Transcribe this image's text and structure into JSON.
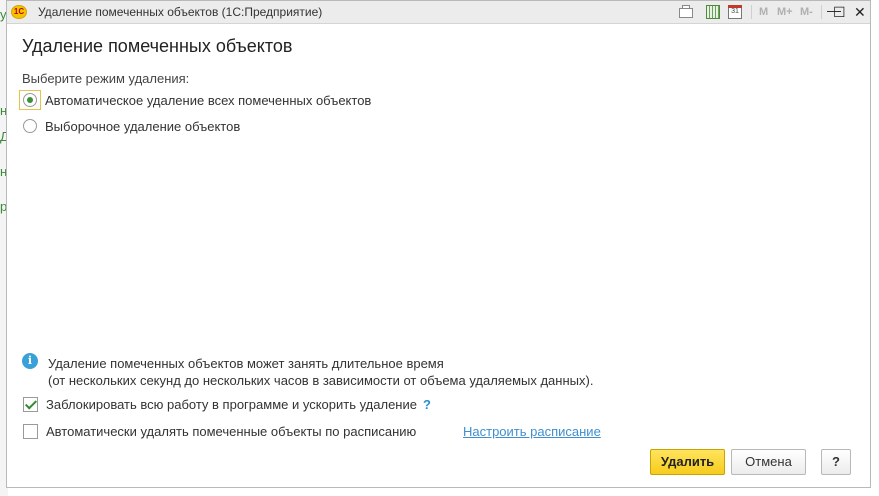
{
  "window": {
    "title": "Удаление помеченных объектов  (1С:Предприятие)",
    "logo_text": "1С",
    "toolbar": {
      "calendar_day": "31",
      "m_label": "M",
      "m_plus_label": "M+",
      "m_minus_label": "M-",
      "minimize_glyph": "—",
      "restore_glyph": "☐",
      "close_glyph": "✕"
    }
  },
  "background_fragments": [
    "у",
    "н",
    "Д",
    "н",
    "р"
  ],
  "heading": "Удаление помеченных объектов",
  "mode_prompt": "Выберите режим удаления:",
  "options": [
    {
      "label": "Автоматическое удаление всех помеченных объектов",
      "selected": true
    },
    {
      "label": "Выборочное удаление объектов",
      "selected": false
    }
  ],
  "info": {
    "icon_glyph": "i",
    "line1": "Удаление помеченных объектов может занять длительное время",
    "line2": "(от нескольких секунд до нескольких часов в зависимости от объема удаляемых данных)."
  },
  "checkboxes": {
    "lock_work": {
      "label": "Заблокировать всю работу в программе и ускорить удаление",
      "checked": true,
      "help": "?"
    },
    "schedule": {
      "label": "Автоматически удалять помеченные объекты по расписанию",
      "checked": false
    }
  },
  "schedule_link": "Настроить расписание",
  "buttons": {
    "delete": "Удалить",
    "cancel": "Отмена",
    "help": "?"
  },
  "colors": {
    "accent_green": "#3d8f3d",
    "primary_button": "#f6cc1c",
    "link": "#3e8fcf",
    "info": "#3aa0d8"
  }
}
